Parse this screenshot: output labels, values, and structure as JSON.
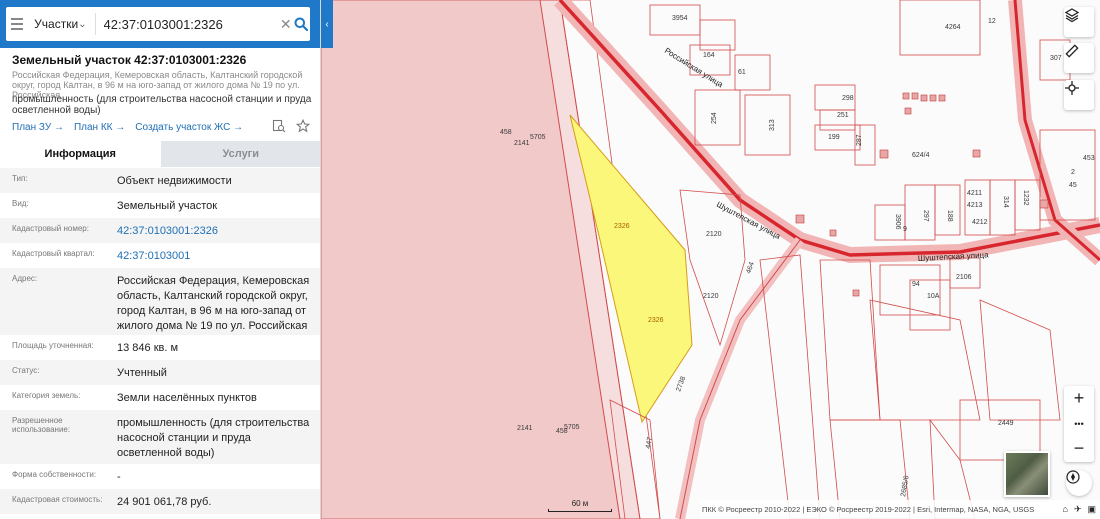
{
  "search": {
    "type_label": "Участки",
    "query": "42:37:0103001:2326",
    "clear": "✕"
  },
  "parcel": {
    "title": "Земельный участок 42:37:0103001:2326",
    "address_short": "Российская Федерация, Кемеровская область, Калтанский городской округ, город Калтан, в 96 м на юго-запад от жилого дома № 19 по ул. Российская",
    "purpose": "промышленность (для строительства насосной станции и пруда осветленной воды)",
    "links": {
      "plan_zu": "План ЗУ →",
      "plan_kk": "План КК →",
      "create": "Создать участок ЖС →"
    }
  },
  "tabs": {
    "info": "Информация",
    "services": "Услуги"
  },
  "properties": [
    {
      "key": "Тип:",
      "value": "Объект недвижимости",
      "link": false
    },
    {
      "key": "Вид:",
      "value": "Земельный участок",
      "link": false
    },
    {
      "key": "Кадастровый номер:",
      "value": "42:37:0103001:2326",
      "link": true
    },
    {
      "key": "Кадастровый квартал:",
      "value": "42:37:0103001",
      "link": true
    },
    {
      "key": "Адрес:",
      "value": "Российская Федерация, Кемеровская область, Калтанский городской округ, город Калтан, в 96 м на юго-запад от жилого дома № 19 по ул. Российская",
      "link": false
    },
    {
      "key": "Площадь уточненная:",
      "value": "13 846 кв. м",
      "link": false
    },
    {
      "key": "Статус:",
      "value": "Учтенный",
      "link": false
    },
    {
      "key": "Категория земель:",
      "value": "Земли населённых пунктов",
      "link": false
    },
    {
      "key": "Разрешенное использование:",
      "value": "промышленность (для строительства насосной станции и пруда осветленной воды)",
      "link": false
    },
    {
      "key": "Форма собственности:",
      "value": "-",
      "link": false
    },
    {
      "key": "Кадастровая стоимость:",
      "value": "24 901 061,78 руб.",
      "link": false
    }
  ],
  "map": {
    "scale_label": "60 м",
    "attribution": "ПКК © Росреестр 2010-2022 | ЕЭКО © Росреестр 2019-2022 | Esri, Intermap, NASA, NGA, USGS",
    "zoom_in": "+",
    "more": "•••",
    "zoom_out": "−",
    "street_labels": [
      "Российская улица",
      "Шуштепская улица",
      "Шуштепская улица"
    ],
    "parcel_labels": [
      "3954",
      "4264",
      "12",
      "164",
      "61",
      "307",
      "298",
      "251",
      "254",
      "313",
      "199",
      "287",
      "624/4",
      "458",
      "5705",
      "2141",
      "2326",
      "2326",
      "2120",
      "2120",
      "4211",
      "4213",
      "1232",
      "3906",
      "297",
      "188",
      "314",
      "4212",
      "453",
      "2",
      "45",
      "2106",
      "94",
      "10А",
      "2738",
      "464",
      "2141",
      "458",
      "5705",
      "447",
      "2449",
      "2685/6",
      "9"
    ]
  },
  "colors": {
    "header": "#1f78c8",
    "link": "#1f6fb5",
    "selected_parcel": "#fbf77a",
    "zone_fill": "#f2c9c9",
    "road": "#e23c3c"
  }
}
